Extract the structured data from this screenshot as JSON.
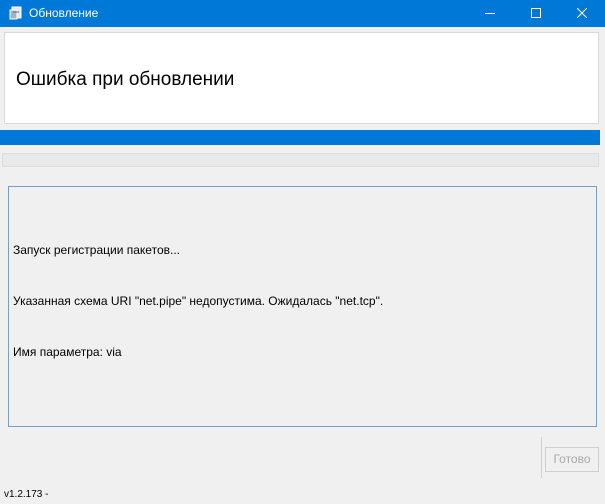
{
  "window": {
    "title": "Обновление",
    "accent_color": "#0078d7",
    "icon": "app-icon",
    "controls": [
      "minimize-icon",
      "maximize-icon",
      "close-icon"
    ]
  },
  "header": {
    "title": "Ошибка при обновлении"
  },
  "progress": {
    "value_percent": 100
  },
  "log": {
    "lines": [
      "Запуск регистрации пакетов...",
      "Указанная схема URI \"net.pipe\" недопустима. Ожидалась \"net.tcp\".",
      "Имя параметра: via"
    ]
  },
  "buttons": {
    "done_label": "Готово",
    "done_enabled": false
  },
  "footer": {
    "version": "v1.2.173 -"
  }
}
